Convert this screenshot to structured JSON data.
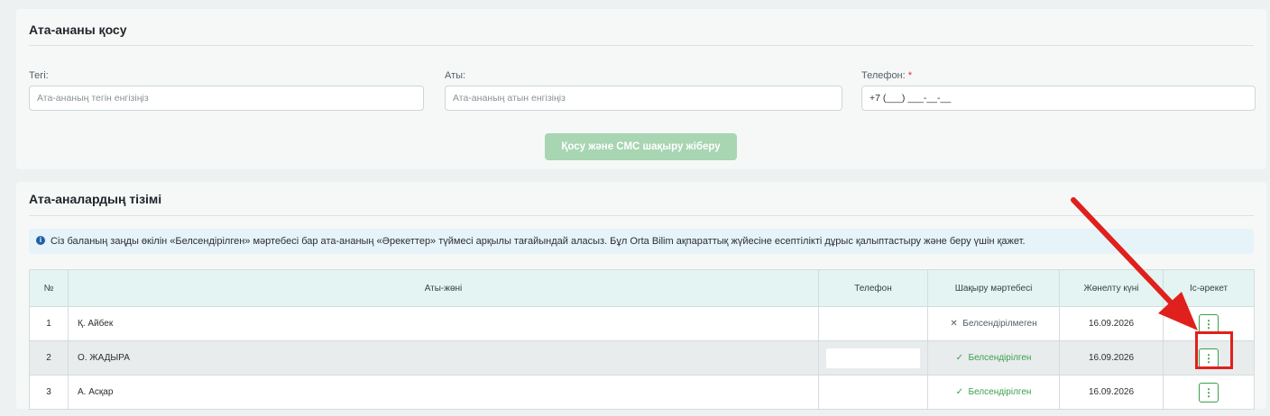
{
  "add_section": {
    "title": "Ата-ананы қосу",
    "surname_label": "Тегі:",
    "surname_placeholder": "Ата-ананың тегін енгізіңіз",
    "name_label": "Аты:",
    "name_placeholder": "Ата-ананың атын енгізіңіз",
    "phone_label": "Телефон:",
    "phone_required": "*",
    "phone_value": "+7 (___) ___-__-__",
    "submit_label": "Қосу және СМС шақыру жіберу"
  },
  "list_section": {
    "title": "Ата-аналардың тізімі",
    "info_icon": "i",
    "info_text": "Сіз баланың заңды өкілін «Белсендірілген» мәртебесі бар ата-ананың «Әрекеттер» түймесі арқылы тағайындай аласыз. Бұл Orta Bilim ақпараттық жүйесіне есептілікті дұрыс қалыптастыру және беру үшін қажет.",
    "columns": [
      "№",
      "Аты-жөні",
      "Телефон",
      "Шақыру мәртебесі",
      "Жөнелту күні",
      "Іс-әрекет"
    ],
    "rows": [
      {
        "num": "1",
        "name": "Қ. Айбек",
        "phone": "",
        "status_icon": "✕",
        "status": "Белсендірілмеген",
        "date": "16.09.2026",
        "action": "⋮"
      },
      {
        "num": "2",
        "name": "О. ЖАДЫРА",
        "phone": "",
        "status_icon": "✓",
        "status": "Белсендірілген",
        "date": "16.09.2026",
        "action": "⋮"
      },
      {
        "num": "3",
        "name": "А. Асқар",
        "phone": "",
        "status_icon": "✓",
        "status": "Белсендірілген",
        "date": "16.09.2026",
        "action": "⋮"
      }
    ]
  },
  "colors": {
    "accent_green": "#3aa04a",
    "button_disabled": "#a8d5b2",
    "annotation_red": "#e0201c"
  }
}
